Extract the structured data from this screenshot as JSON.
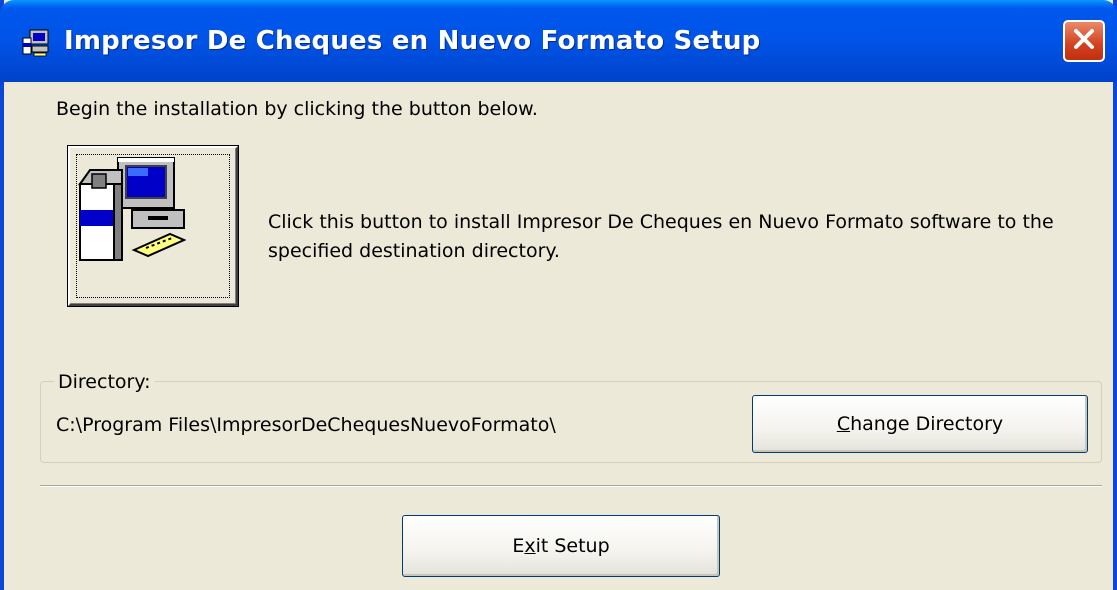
{
  "window": {
    "title": "Impresor De Cheques en Nuevo Formato Setup",
    "title_icon": "setup-computer-icon",
    "close_icon": "close-icon",
    "title_bar_color": "#0054e3",
    "close_button_color": "#d3411e"
  },
  "main": {
    "instruction": "Begin the installation by clicking the button below.",
    "install_button_icon": "setup-computer-icon",
    "install_description": "Click this button to install Impresor De Cheques en Nuevo Formato software to the specified destination directory."
  },
  "directory": {
    "legend": "Directory:",
    "path": "C:\\Program Files\\ImpresorDeChequesNuevoFormato\\",
    "change_button_prefix": "",
    "change_button_mnemonic": "C",
    "change_button_rest": "hange Directory"
  },
  "footer": {
    "exit_button_prefix": "E",
    "exit_button_mnemonic": "x",
    "exit_button_rest": "it Setup"
  }
}
